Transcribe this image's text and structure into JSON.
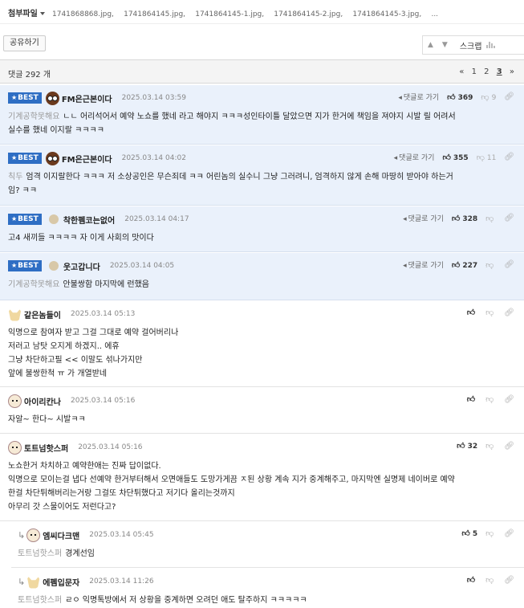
{
  "attachments": {
    "label": "첨부파일",
    "files": [
      "1741868868.jpg,",
      "1741864145.jpg,",
      "1741864145-1.jpg,",
      "1741864145-2.jpg,",
      "1741864145-3.jpg,",
      "..."
    ]
  },
  "toolbar": {
    "share_label": "공유하기",
    "up_arrow": "▲",
    "down_arrow": "▼",
    "scrap_label": "스크랩"
  },
  "comments_header": {
    "count_label": "댓글 292 개",
    "pager": {
      "prev": "«",
      "pages": [
        "1",
        "2",
        "3"
      ],
      "current": "3",
      "next": "»"
    }
  },
  "comments": [
    {
      "best": true,
      "badge": "BEST",
      "nick": "FM은근본이다",
      "date": "2025.03.14 03:59",
      "reply_label": "댓글로 가기",
      "up": "369",
      "down": "9",
      "from": "기계공학못해요",
      "lines": [
        "ㄴㄴ 어리석어서 예약 노쇼를 했네 라고 해야지 ㅋㅋㅋ성인타이틀 달았으면 지가 한거에 책임을 져야지 시발 릴 어려서",
        "실수를 했네 이지랄 ㅋㅋㅋㅋ"
      ]
    },
    {
      "best": true,
      "badge": "BEST",
      "nick": "FM은근본이다",
      "date": "2025.03.14 04:02",
      "reply_label": "댓글로 가기",
      "up": "355",
      "down": "11",
      "from": "칙두",
      "lines": [
        "엄격 이지랄한다 ㅋㅋㅋ 저 소상공인은 무슨죄데 ㅋㅋ 어린놈의 실수니 그냥 그러려니, 엄격하지 않게 손해 마땅히 받아야 하는거",
        "임? ㅋㅋ"
      ]
    },
    {
      "best": true,
      "badge": "BEST",
      "nick": "착한펨코는없어",
      "date": "2025.03.14 04:17",
      "reply_label": "댓글로 가기",
      "up": "328",
      "down": "",
      "from": "",
      "lines": [
        "고4 새끼들 ㅋㅋㅋㅋ 자 이게 사회의 맛이다"
      ]
    },
    {
      "best": true,
      "badge": "BEST",
      "nick": "웃고갑니다",
      "date": "2025.03.14 04:05",
      "reply_label": "댓글로 가기",
      "up": "227",
      "down": "",
      "from": "기계공학못해요",
      "lines": [
        "안불쌍함 마지막에 런했음"
      ]
    },
    {
      "best": false,
      "nick": "같은놈들이",
      "date": "2025.03.14 05:13",
      "up": "",
      "down": "",
      "from": "",
      "lines": [
        "익명으로 참여자 받고 그걸 그대로 예약 걸어버리나",
        "저러고 남탓 오지게 하겠지.. 에휴",
        "그냥 차단하고필 << 이말도 섞나가지만",
        "앞에 불쌍한척 ㅠ 가 개열받네"
      ]
    },
    {
      "best": false,
      "nick": "아이리칸나",
      "date": "2025.03.14 05:16",
      "up": "",
      "down": "",
      "from": "",
      "lines": [
        "자알~ 한다~ 시발ㅋㅋ"
      ]
    },
    {
      "best": false,
      "nick": "토트넘핫스퍼",
      "date": "2025.03.14 05:16",
      "up": "32",
      "down": "",
      "from": "",
      "lines": [
        "노쇼한거 차치하고 예약한애는 진짜 답이없다.",
        "익명으로 모이는걸 냅다 선예약 한거부터해서 오면애들도 도망가게끔 ㅈ된 상황 계속 지가 중계해주고, 마지막엔 실명제 네이버로 예약",
        "한걸 차단튀해버리는거랑 그걸또 차단튀했다고 저기다 올리는것까지",
        "아무리 갓 스물이어도 저런다고?"
      ]
    },
    {
      "best": false,
      "reply": true,
      "nick": "엠씨다크맨",
      "date": "2025.03.14 05:45",
      "up": "5",
      "down": "",
      "from": "토트넘핫스퍼",
      "lines": [
        "경계선임"
      ]
    },
    {
      "best": false,
      "reply": true,
      "nick": "에펨입문자",
      "date": "2025.03.14 11:26",
      "up": "",
      "down": "",
      "from": "토트넘핫스퍼",
      "lines": [
        "ㄹㅇ 익명톡방에서 저 상황을 중계하면 오려던 애도 탈주하지 ㅋㅋㅋㅋㅋ"
      ]
    }
  ]
}
